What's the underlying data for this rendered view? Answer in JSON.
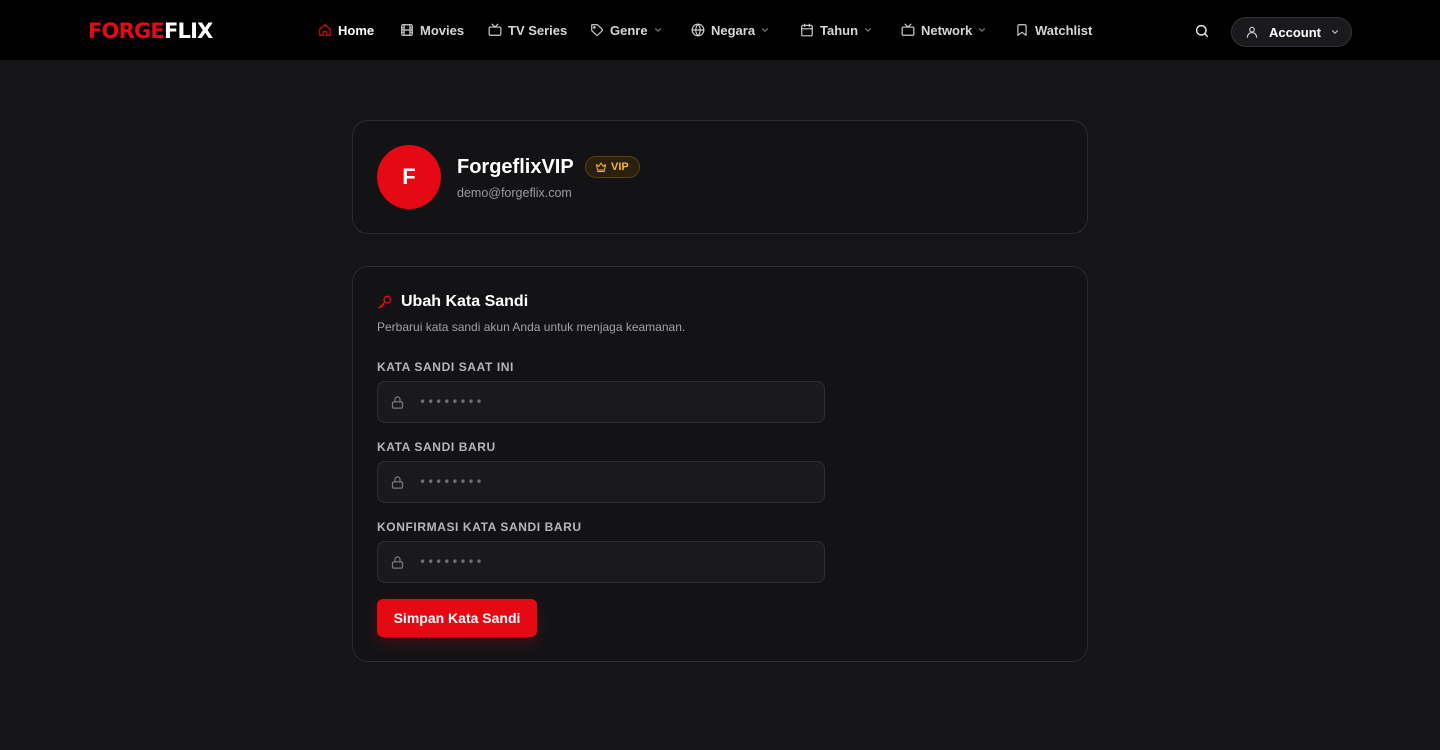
{
  "brand": {
    "logo_part1": "FORGE",
    "logo_part2": "FLIX",
    "accent_color": "#e50914"
  },
  "nav": {
    "home": "Home",
    "movies": "Movies",
    "tv_series": "TV Series",
    "genre": "Genre",
    "negara": "Negara",
    "tahun": "Tahun",
    "network": "Network",
    "watchlist": "Watchlist"
  },
  "account": {
    "label": "Account"
  },
  "profile": {
    "initial": "F",
    "name": "ForgeflixVIP",
    "badge": "VIP",
    "email": "demo@forgeflix.com"
  },
  "password_form": {
    "title": "Ubah Kata Sandi",
    "description": "Perbarui kata sandi akun Anda untuk menjaga keamanan.",
    "current_label": "KATA SANDI SAAT INI",
    "current_placeholder": "••••••••",
    "new_label": "KATA SANDI BARU",
    "new_placeholder": "••••••••",
    "confirm_label": "KONFIRMASI KATA SANDI BARU",
    "confirm_placeholder": "••••••••",
    "submit_label": "Simpan Kata Sandi"
  }
}
